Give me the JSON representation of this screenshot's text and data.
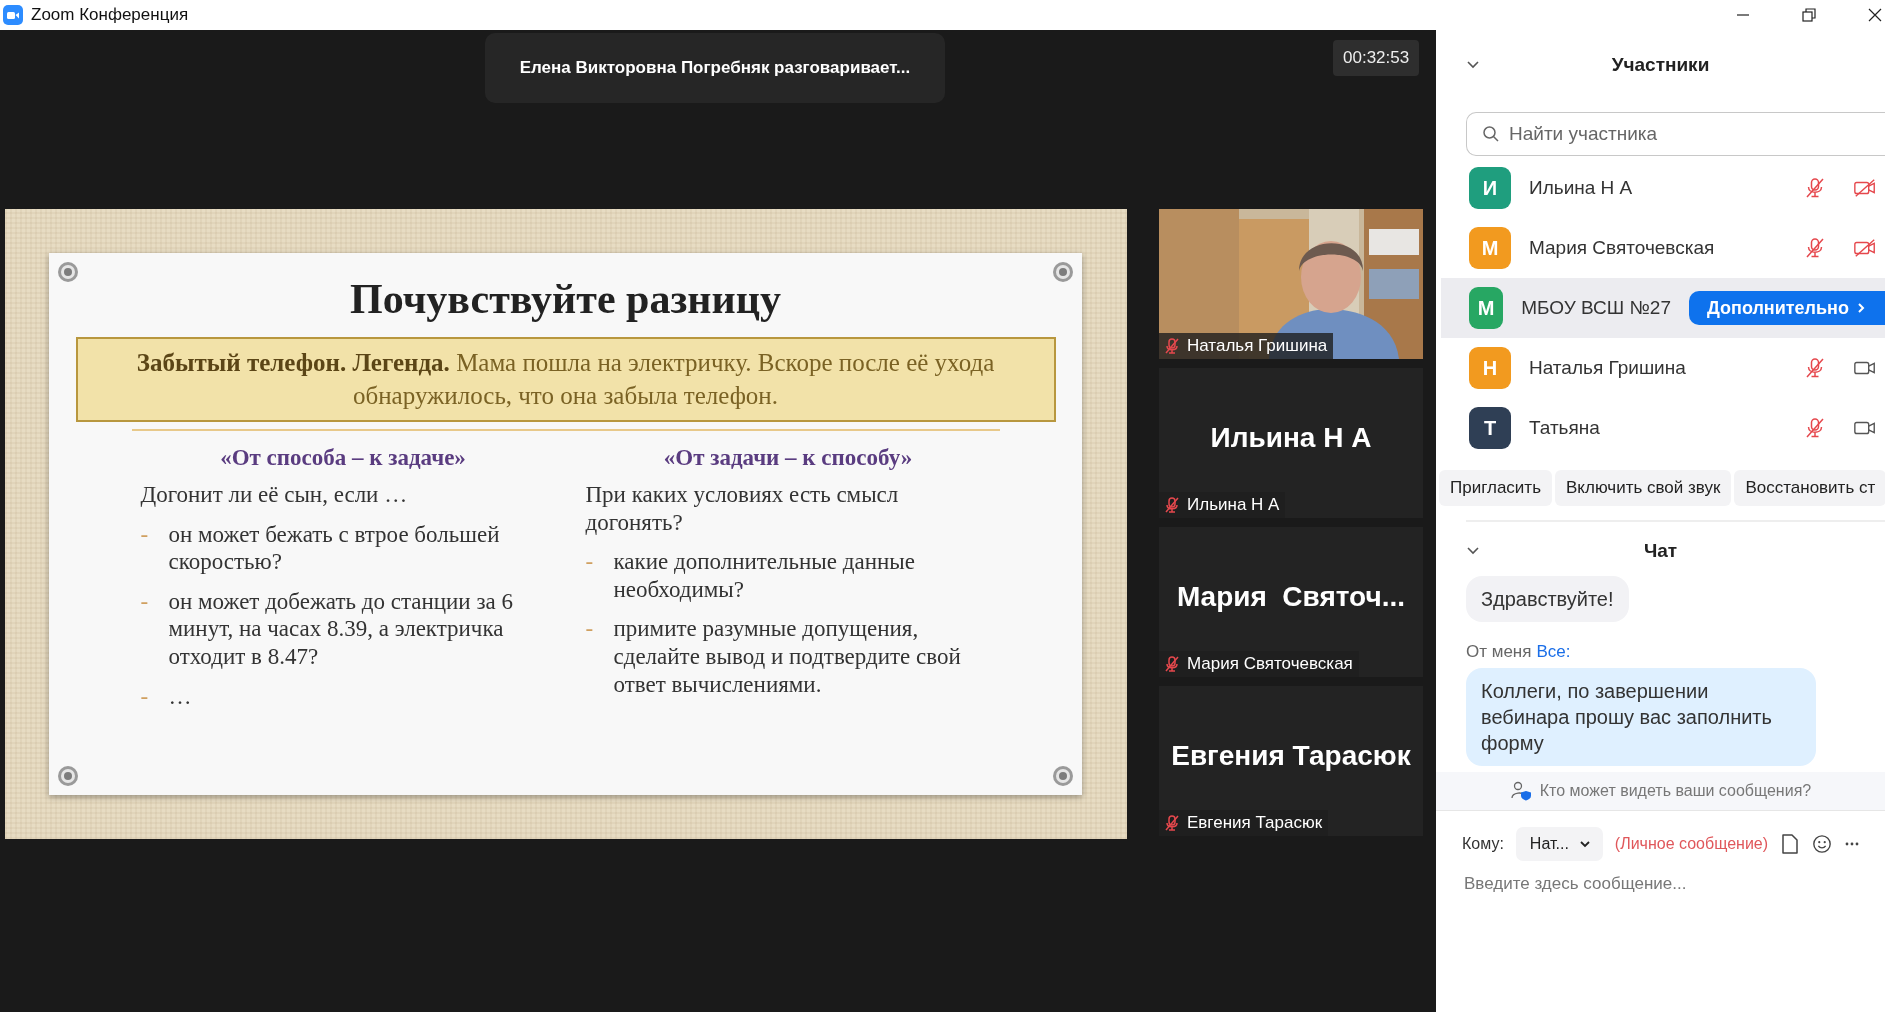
{
  "window": {
    "title": "Zoom Конференция"
  },
  "stage": {
    "speaker_banner": "Елена Викторовна Погребняк разговаривает...",
    "timer": "00:32:53"
  },
  "slide": {
    "title": "Почувствуйте разницу",
    "legend": "**Забытый телефон. Легенда.** Мама пошла на электричку. Вскоре после её ухода обнаружилось, что она забыла телефон.",
    "columns": [
      {
        "heading": "«От способа – к задаче»",
        "intro": "Догонит ли её сын, если …",
        "bullets": [
          {
            "marker": "-",
            "text": "он может бежать с втрое большей скоростью?"
          },
          {
            "marker": "-",
            "text": "он может добежать до станции за 6 минут, на часах 8.39, а электричка отходит в 8.47?"
          },
          {
            "marker": "-",
            "text": "…"
          }
        ]
      },
      {
        "heading": "«От задачи – к способу»",
        "intro": "При каких условиях есть смысл догонять?",
        "bullets": [
          {
            "marker": "-",
            "text": "какие дополнительные данные необходимы?"
          },
          {
            "marker": "-",
            "text": "примите разумные допущения, сделайте вывод и подтвердите свой ответ вычислениями."
          }
        ]
      }
    ]
  },
  "video_tiles": [
    {
      "kind": "video",
      "label": "Наталья Гришина",
      "muted": true
    },
    {
      "kind": "name",
      "display_name": "Ильина Н А",
      "label": "Ильина Н А",
      "muted": true
    },
    {
      "kind": "name",
      "display_name": "Мария  Святоч...",
      "label": "Мария Святочевская",
      "muted": true
    },
    {
      "kind": "name",
      "display_name": "Евгения Тарасюк",
      "label": "Евгения Тарасюк",
      "muted": true
    }
  ],
  "participants": {
    "title": "Участники",
    "search": {
      "placeholder": "Найти участника"
    },
    "rows": [
      {
        "initial": "И",
        "name": "Ильина Н А",
        "color": "#1f9e7e",
        "hovered": false,
        "mic_muted": true,
        "video_off": true
      },
      {
        "initial": "М",
        "name": "Мария Святочевская",
        "color": "#f29a1f",
        "hovered": false,
        "mic_muted": true,
        "video_off": true
      },
      {
        "initial": "М",
        "name": "МБОУ ВСШ №27",
        "color": "#27a763",
        "hovered": true,
        "action": "Дополнительно"
      },
      {
        "initial": "Н",
        "name": "Наталья Гришина",
        "color": "#f29a1f",
        "hovered": false,
        "mic_muted": true,
        "video_off": false
      },
      {
        "initial": "Т",
        "name": "Татьяна",
        "color": "#2f3f55",
        "hovered": false,
        "mic_muted": true,
        "video_off": false
      }
    ],
    "buttons": [
      "Пригласить",
      "Включить свой звук",
      "Восстановить ст"
    ]
  },
  "chat": {
    "title": "Чат",
    "messages": [
      {
        "own": false,
        "text": "Здравствуйте!"
      },
      {
        "own": true,
        "sender": "От меня",
        "recipient": "Все:",
        "text": "Коллеги, по завершении вебинара прошу вас заполнить форму"
      }
    ],
    "privacy_notice": "Кто может видеть ваши сообщения?",
    "to_label": "Кому:",
    "recipient": "Нат...",
    "private_note": "(Личное сообщение)",
    "input": {
      "placeholder": "Введите здесь сообщение..."
    }
  }
}
